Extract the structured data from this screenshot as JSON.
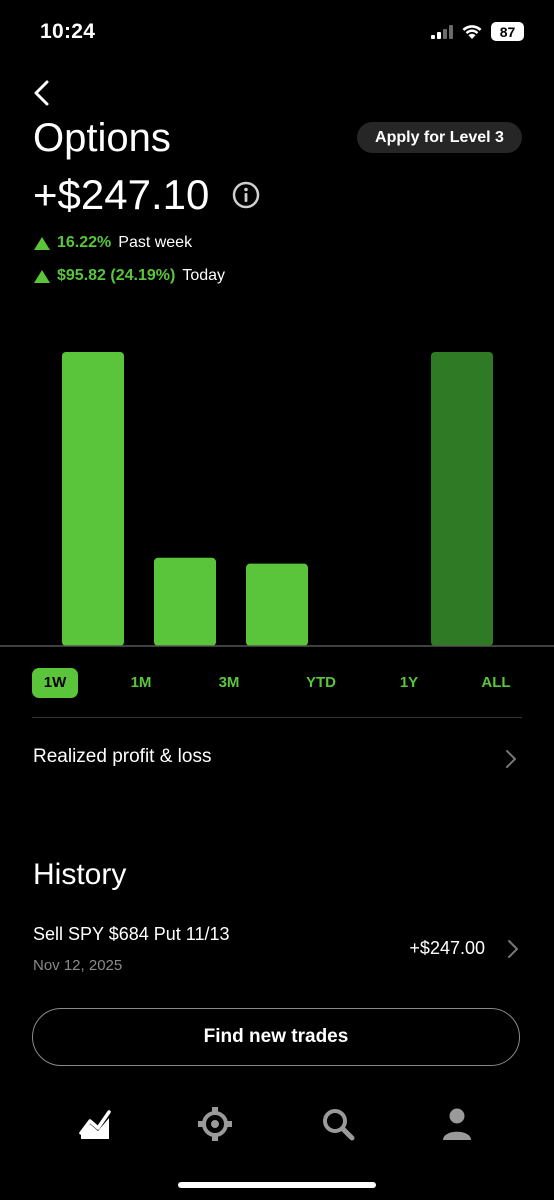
{
  "status_bar": {
    "time": "10:24",
    "battery": "87"
  },
  "header": {
    "title": "Options",
    "level_button": "Apply for Level 3",
    "balance": "+$247.10"
  },
  "stats": {
    "week_change": "16.22%",
    "week_label": "Past week",
    "today_change": "$95.82 (24.19%)",
    "today_label": "Today"
  },
  "chart_data": {
    "type": "bar",
    "values": [
      1.0,
      0.3,
      0.28,
      0,
      1.0
    ],
    "colors": [
      "#5ac53b",
      "#5ac53b",
      "#5ac53b",
      "#5ac53b",
      "#2f7a24"
    ]
  },
  "ranges": {
    "items": [
      "1W",
      "1M",
      "3M",
      "YTD",
      "1Y",
      "ALL"
    ],
    "selected": "1W"
  },
  "realized": {
    "label": "Realized profit & loss"
  },
  "history": {
    "title": "History",
    "items": [
      {
        "title": "Sell SPY $684 Put 11/13",
        "date": "Nov 12, 2025",
        "amount": "+$247.00"
      }
    ]
  },
  "find_button": "Find new trades",
  "bottom_nav": [
    "chart-icon",
    "options-icon",
    "search-icon",
    "account-icon"
  ],
  "colors": {
    "accent": "#5ac53b",
    "accent_dark": "#2f7a24",
    "background": "#000000"
  }
}
